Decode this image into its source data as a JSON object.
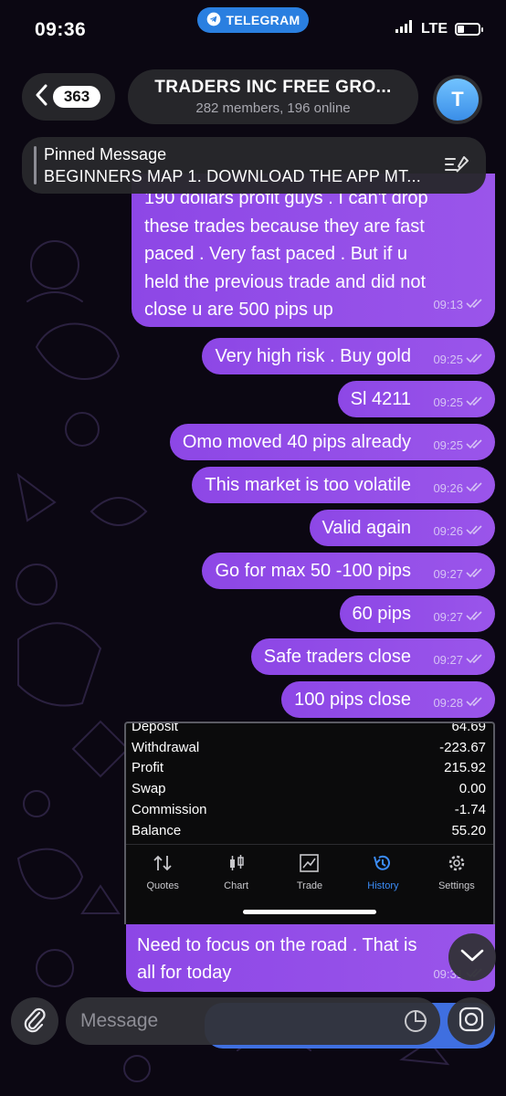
{
  "status_bar": {
    "time": "09:36",
    "app_pill": "TELEGRAM",
    "network": "LTE",
    "battery_level": 0.3
  },
  "header": {
    "back_count": "363",
    "title": "TRADERS INC FREE GRO...",
    "subtitle": "282 members, 196 online",
    "avatar_letter": "T"
  },
  "pinned": {
    "title": "Pinned Message",
    "text": "BEGINNERS MAP 1. DOWNLOAD THE APP MT..."
  },
  "messages": [
    {
      "lines": [
        "190 dollars profit guys . I can't drop",
        "these trades because they are fast",
        "paced . Very fast paced . But if u",
        "held the previous trade and did not",
        "close u are 500 pips up"
      ],
      "time": "09:13"
    },
    {
      "text": "Very high risk . Buy gold",
      "time": "09:25"
    },
    {
      "text": "Sl 4211",
      "time": "09:25"
    },
    {
      "text": "Omo moved 40 pips already",
      "time": "09:25"
    },
    {
      "text": "This market is too volatile",
      "time": "09:26"
    },
    {
      "text": "Valid again",
      "time": "09:26"
    },
    {
      "text": "Go for max 50 -100 pips",
      "time": "09:27"
    },
    {
      "text": "60 pips",
      "time": "09:27"
    },
    {
      "text": "Safe traders close",
      "time": "09:27"
    },
    {
      "text": "100 pips close",
      "time": "09:28"
    }
  ],
  "media_screenshot": {
    "rows": [
      {
        "label": "Deposit",
        "value": "64.69"
      },
      {
        "label": "Withdrawal",
        "value": "-223.67"
      },
      {
        "label": "Profit",
        "value": "215.92"
      },
      {
        "label": "Swap",
        "value": "0.00"
      },
      {
        "label": "Commission",
        "value": "-1.74"
      },
      {
        "label": "Balance",
        "value": "55.20"
      }
    ],
    "tabs": [
      {
        "label": "Quotes",
        "icon": "quotes-arrows-icon"
      },
      {
        "label": "Chart",
        "icon": "candlestick-icon"
      },
      {
        "label": "Trade",
        "icon": "trade-chart-icon"
      },
      {
        "label": "History",
        "icon": "history-clock-icon",
        "active": true
      },
      {
        "label": "Settings",
        "icon": "gear-icon"
      }
    ],
    "active_color": "#3b8cf7"
  },
  "last_message": {
    "lines": [
      "Need to focus on the road . That is",
      "all for today"
    ],
    "time": "09:31"
  },
  "input": {
    "placeholder": "Message"
  },
  "colors": {
    "bubble": "#9a55ea",
    "telegram_blue": "#2a7fe0",
    "background": "#0b0712"
  }
}
